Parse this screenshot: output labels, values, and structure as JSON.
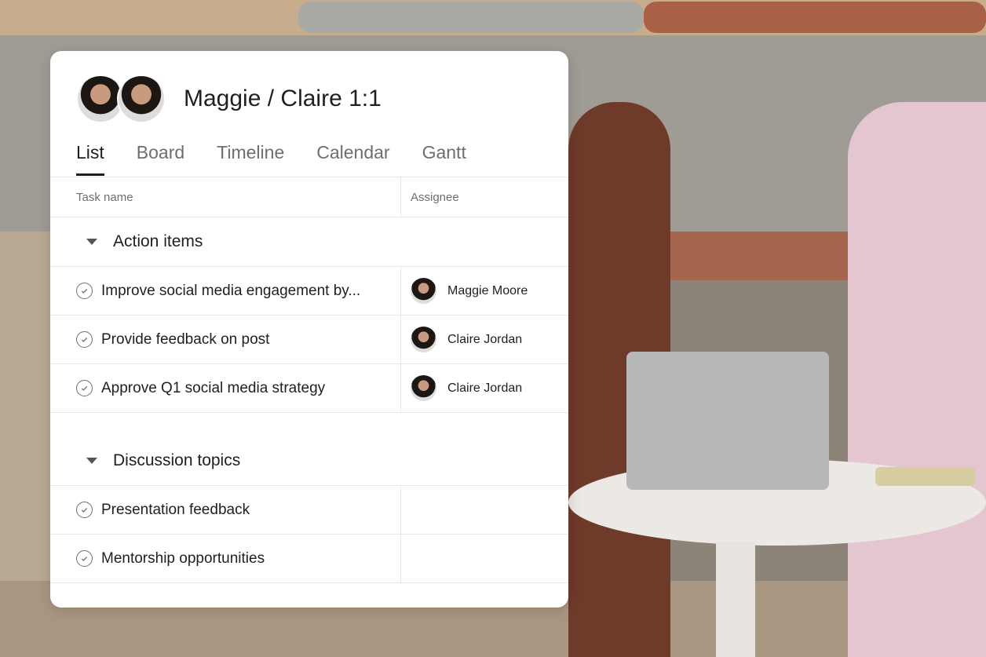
{
  "project": {
    "title": "Maggie / Claire 1:1",
    "members": [
      "Maggie Moore",
      "Claire Jordan"
    ]
  },
  "tabs": [
    {
      "label": "List",
      "active": true
    },
    {
      "label": "Board"
    },
    {
      "label": "Timeline"
    },
    {
      "label": "Calendar"
    },
    {
      "label": "Gantt"
    }
  ],
  "columns": {
    "task": "Task name",
    "assignee": "Assignee"
  },
  "sections": [
    {
      "name": "Action items",
      "tasks": [
        {
          "name": "Improve social media engagement by...",
          "assignee": "Maggie Moore"
        },
        {
          "name": "Provide feedback on post",
          "assignee": "Claire Jordan"
        },
        {
          "name": "Approve Q1 social media strategy",
          "assignee": "Claire Jordan"
        }
      ]
    },
    {
      "name": "Discussion topics",
      "tasks": [
        {
          "name": "Presentation feedback",
          "assignee": ""
        },
        {
          "name": "Mentorship opportunities",
          "assignee": ""
        }
      ]
    }
  ],
  "icons": {
    "section_toggle": "caret-down-icon",
    "task_status": "check-circle-icon"
  }
}
